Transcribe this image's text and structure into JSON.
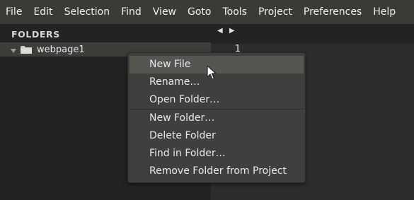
{
  "menubar": {
    "items": [
      "File",
      "Edit",
      "Selection",
      "Find",
      "View",
      "Goto",
      "Tools",
      "Project",
      "Preferences",
      "Help"
    ]
  },
  "sidebar": {
    "header": "FOLDERS",
    "folder": {
      "name": "webpage1",
      "expanded": true
    }
  },
  "editor": {
    "tab_arrows": "◀ ▶",
    "line_numbers": [
      "1"
    ]
  },
  "context_menu": {
    "hovered_item": "New File",
    "groups": [
      [
        "New File",
        "Rename…",
        "Open Folder…"
      ],
      [
        "New Folder…",
        "Delete Folder",
        "Find in Folder…",
        "Remove Folder from Project"
      ]
    ]
  },
  "colors": {
    "menubar_bg": "#3a3a37",
    "sidebar_bg": "#232323",
    "editor_bg": "#2d2d2b",
    "menu_bg": "#3f3f3d",
    "menu_hover_bg": "#555552"
  }
}
